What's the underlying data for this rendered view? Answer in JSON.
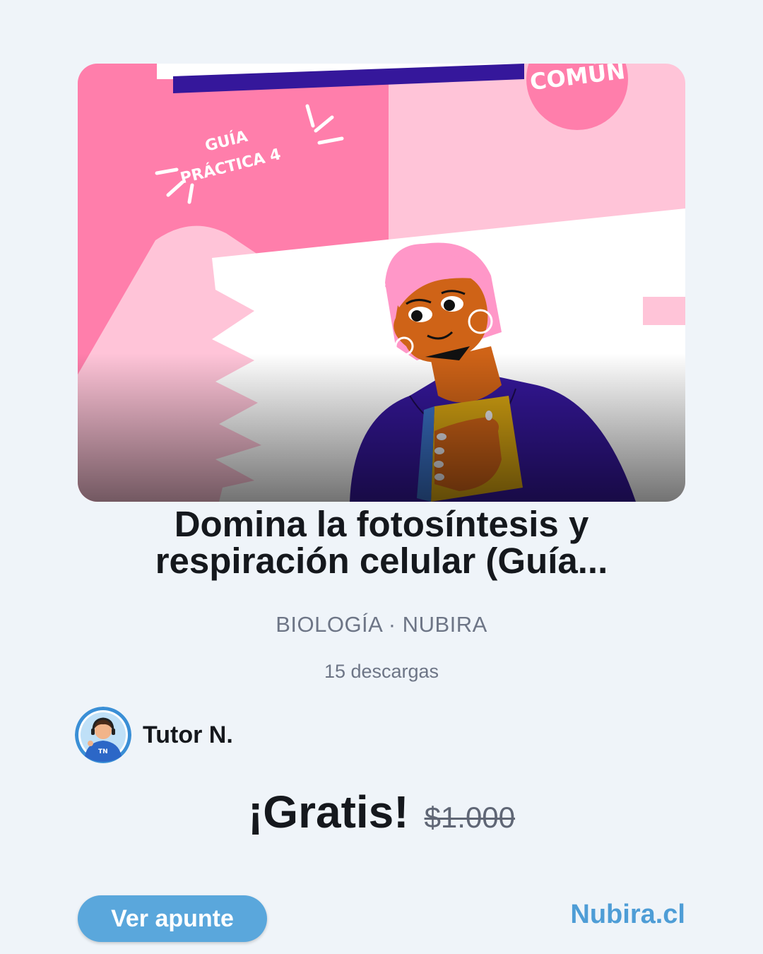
{
  "cover": {
    "badge_text": "COMÚN",
    "guide_text_line1": "GUÍA",
    "guide_text_line2": "PRÁCTICA 4",
    "colors": {
      "pink": "#ff7eab",
      "light_pink": "#ffc4d8",
      "purple": "#35179b",
      "skin": "#cf6317",
      "hair": "#ff97c8"
    }
  },
  "title": "Domina la fotosíntesis y respiración celular (Guía...",
  "meta": "BIOLOGÍA · NUBIRA",
  "downloads": "15 descargas",
  "author": {
    "name": "Tutor N.",
    "avatar_icon": "tutor-avatar-icon"
  },
  "price": {
    "current": "¡Gratis!",
    "original": "$1.000"
  },
  "cta": {
    "label": "Ver apunte"
  },
  "brand": {
    "label": "Nubira.cl",
    "color": "#4e9dd6"
  },
  "colors": {
    "background": "#eff4f9",
    "cta": "#5aa7dc",
    "text": "#15181d",
    "muted": "#6d7586"
  }
}
